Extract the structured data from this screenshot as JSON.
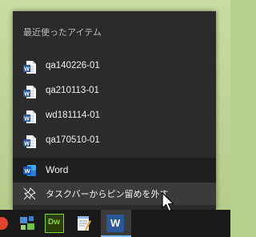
{
  "jumplist": {
    "section_title": "最近使ったアイテム",
    "recent_items": [
      {
        "label": "qa140226-01",
        "icon": "word-doc-icon"
      },
      {
        "label": "qa210113-01",
        "icon": "word-doc-icon"
      },
      {
        "label": "wd181114-01",
        "icon": "word-doc-icon"
      },
      {
        "label": "qa170510-01",
        "icon": "word-doc-icon"
      }
    ],
    "app": {
      "label": "Word",
      "icon": "word-app-icon"
    },
    "unpin": {
      "label": "タスクバーからピン留めを外す",
      "icon": "unpin-icon"
    }
  },
  "taskbar": {
    "items": [
      {
        "name": "red-app-icon"
      },
      {
        "name": "network-app-icon"
      },
      {
        "name": "dreamweaver-icon",
        "text": "Dw"
      },
      {
        "name": "notepad-icon"
      },
      {
        "name": "word-icon",
        "text": "W",
        "active": true
      }
    ]
  },
  "colors": {
    "menu_bg": "#2b2b2b",
    "hover_bg": "#3b3b3b",
    "taskbar_bg": "#191919",
    "word_blue": "#2b579a",
    "accent": "#76b9ed"
  }
}
